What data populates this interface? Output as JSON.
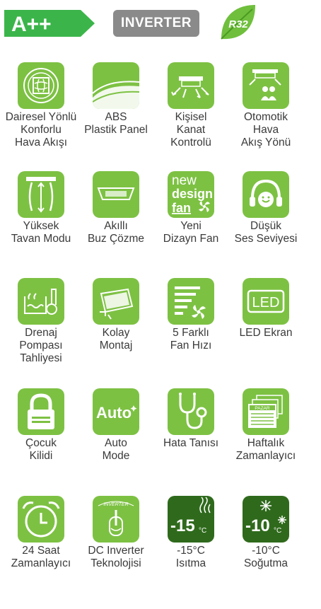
{
  "badges": {
    "energy": "A++",
    "inverter": "INVERTER",
    "refrigerant": "R32"
  },
  "features": [
    {
      "icon": "circular-airflow-icon",
      "lines": [
        "Dairesel Yönlü",
        "Konforlu",
        "Hava Akışı"
      ]
    },
    {
      "icon": "abs-panel-icon",
      "lines": [
        "ABS",
        "Plastik Panel"
      ]
    },
    {
      "icon": "individual-flap-icon",
      "lines": [
        "Kişisel",
        "Kanat",
        "Kontrolü"
      ]
    },
    {
      "icon": "auto-airflow-icon",
      "lines": [
        "Otomotik",
        "Hava",
        "Akış Yönü"
      ]
    },
    {
      "icon": "high-ceiling-icon",
      "lines": [
        "Yüksek",
        "Tavan Modu"
      ]
    },
    {
      "icon": "smart-defrost-icon",
      "lines": [
        "Akıllı",
        "Buz Çözme"
      ]
    },
    {
      "icon": "new-design-fan-icon",
      "lines": [
        "Yeni",
        "Dizayn Fan"
      ],
      "tile_text": [
        "new",
        "design",
        "fan"
      ]
    },
    {
      "icon": "low-noise-icon",
      "lines": [
        "Düşük",
        "Ses Seviyesi"
      ]
    },
    {
      "icon": "drain-pump-icon",
      "lines": [
        "Drenaj",
        "Pompası",
        "Tahliyesi"
      ]
    },
    {
      "icon": "easy-install-icon",
      "lines": [
        "Kolay",
        "Montaj"
      ]
    },
    {
      "icon": "fan-speed-icon",
      "lines": [
        "5 Farklı",
        "Fan Hızı"
      ]
    },
    {
      "icon": "led-display-icon",
      "lines": [
        "LED Ekran"
      ],
      "tile_text": [
        "LED"
      ]
    },
    {
      "icon": "child-lock-icon",
      "lines": [
        "Çocuk",
        "Kilidi"
      ]
    },
    {
      "icon": "auto-mode-icon",
      "lines": [
        "Auto",
        "Mode"
      ],
      "tile_text": [
        "Auto"
      ]
    },
    {
      "icon": "diagnosis-icon",
      "lines": [
        "Hata Tanısı"
      ]
    },
    {
      "icon": "weekly-timer-icon",
      "lines": [
        "Haftalık",
        "Zamanlayıcı"
      ],
      "tile_text": [
        "PAZAR"
      ]
    },
    {
      "icon": "alarm-clock-icon",
      "lines": [
        "24 Saat",
        "Zamanlayıcı"
      ]
    },
    {
      "icon": "dc-inverter-icon",
      "lines": [
        "DC Inverter",
        "Teknolojisi"
      ],
      "tile_text": [
        "INVERTER"
      ]
    },
    {
      "icon": "heating-icon",
      "lines": [
        "-15°C",
        "Isıtma"
      ],
      "tile_text": [
        "-15",
        "°C"
      ]
    },
    {
      "icon": "cooling-icon",
      "lines": [
        "-10°C",
        "Soğutma"
      ],
      "tile_text": [
        "-10",
        "°C"
      ]
    }
  ],
  "colors": {
    "tile": "#7dc143",
    "tile_dark": "#2f6a1c",
    "text": "#3a3a3a",
    "inverter_badge": "#8a8a8a"
  }
}
